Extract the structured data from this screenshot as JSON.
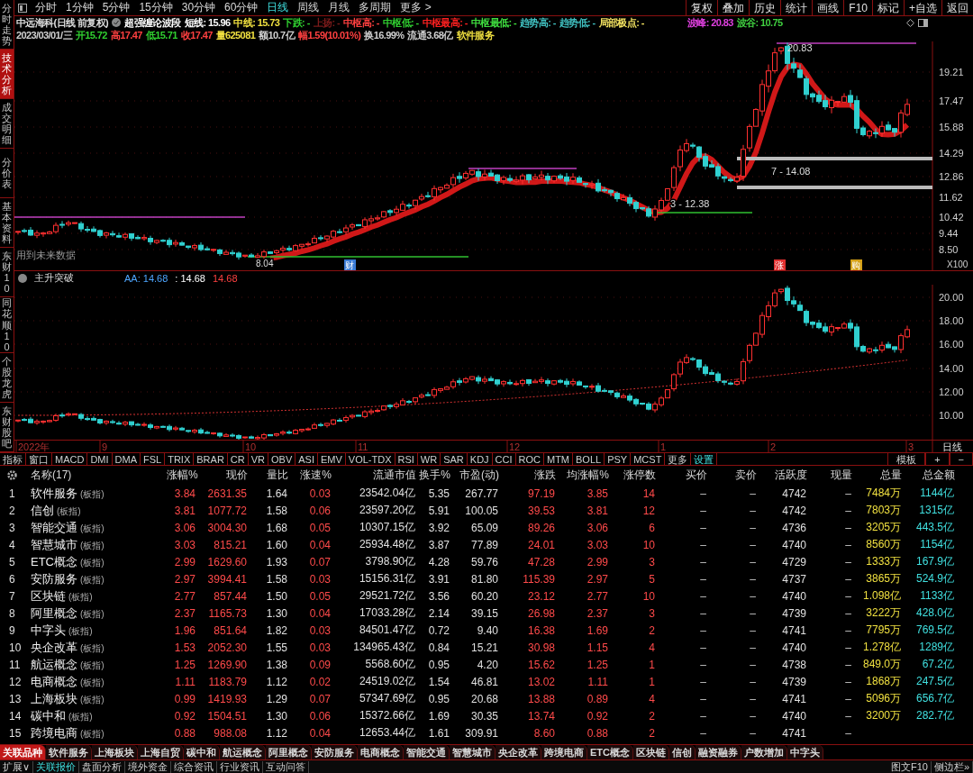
{
  "sidebar": {
    "tabs": [
      {
        "label": "分时走势",
        "selected": false
      },
      {
        "label": "技术分析",
        "selected": true
      },
      {
        "label": "成交明细",
        "selected": false
      },
      {
        "label": "分价表",
        "selected": false
      },
      {
        "label": "基本资料",
        "selected": false
      },
      {
        "label": "东财10",
        "selected": false
      },
      {
        "label": "同花顺10",
        "selected": false
      },
      {
        "label": "个股龙虎",
        "selected": false
      },
      {
        "label": "东财股吧",
        "selected": false
      }
    ]
  },
  "toolbar": {
    "periods": [
      {
        "label": "分时",
        "selected": false
      },
      {
        "label": "1分钟",
        "selected": false
      },
      {
        "label": "5分钟",
        "selected": false
      },
      {
        "label": "15分钟",
        "selected": false
      },
      {
        "label": "30分钟",
        "selected": false
      },
      {
        "label": "60分钟",
        "selected": false
      },
      {
        "label": "日线",
        "selected": true
      },
      {
        "label": "周线",
        "selected": false
      },
      {
        "label": "月线",
        "selected": false
      },
      {
        "label": "多周期",
        "selected": false
      },
      {
        "label": "更多 >",
        "selected": false
      }
    ],
    "buttons": [
      "复权",
      "叠加",
      "历史",
      "统计",
      "画线",
      "F10",
      "标记",
      "+自选",
      "返回"
    ]
  },
  "quote_header": {
    "title": "中远海科(日线 前复权)",
    "indicator": "超强缠论波段",
    "items": [
      {
        "text": "短线: 15.96",
        "color": "#ffffff"
      },
      {
        "text": "中线: 15.73",
        "color": "#f0e040"
      },
      {
        "text": "下跌: -",
        "color": "#30d030"
      },
      {
        "text": "上扬: -",
        "color": "#7a1a1a"
      },
      {
        "text": "中枢高: -",
        "color": "#ff4040"
      },
      {
        "text": "中枢低: -",
        "color": "#30d030"
      },
      {
        "text": "中枢最高: -",
        "color": "#ff2020"
      },
      {
        "text": "中枢最低: -",
        "color": "#40e040"
      },
      {
        "text": "趋势高: -",
        "color": "#40c0c0"
      },
      {
        "text": "趋势低: -",
        "color": "#40c0c0"
      },
      {
        "text": "局部极点: -",
        "color": "#f0e060"
      }
    ],
    "extremes": [
      {
        "text": "波峰: 20.83",
        "color": "#e040e0"
      },
      {
        "text": "波谷: 10.75",
        "color": "#40d040"
      }
    ]
  },
  "ohlc_line": [
    {
      "text": "2023/03/01/三",
      "color": "#d0d0d0"
    },
    {
      "text": "开15.72",
      "color": "#30d030"
    },
    {
      "text": "高17.47",
      "color": "#ff4040"
    },
    {
      "text": "低15.71",
      "color": "#30d030"
    },
    {
      "text": "收17.47",
      "color": "#ff4040"
    },
    {
      "text": "量625081",
      "color": "#f0e040"
    },
    {
      "text": "额10.7亿",
      "color": "#d0d0d0"
    },
    {
      "text": "幅1.59(10.01%)",
      "color": "#ff4040"
    },
    {
      "text": "换16.99%",
      "color": "#d0d0d0"
    },
    {
      "text": "流通3.68亿",
      "color": "#d0d0d0"
    },
    {
      "text": "软件服务",
      "color": "#f0e040"
    }
  ],
  "main_chart": {
    "y_labels": [
      "19.21",
      "17.47",
      "15.88",
      "14.29",
      "12.86",
      "11.62",
      "10.42",
      "9.44",
      "8.50"
    ],
    "scale": "X100",
    "peak_label": "20.83",
    "low_label": "8.04",
    "level_labels": [
      "7 - 14.08",
      "3 - 12.38"
    ],
    "note": "用到未来数据",
    "markers": [
      {
        "text": "财",
        "color": "#3a7bd5"
      },
      {
        "text": "涨",
        "color": "#e03030"
      },
      {
        "text": "购",
        "color": "#d4a017"
      }
    ]
  },
  "sub_chart": {
    "name": "主升突破",
    "values": [
      {
        "text": "AA: 14.68",
        "color": "#4da6ff"
      },
      {
        "text": ": 14.68",
        "color": "#ffffff"
      },
      {
        "text": "14.68",
        "color": "#ff4040"
      }
    ],
    "y_labels": [
      "20.00",
      "18.00",
      "16.00",
      "14.00",
      "12.00",
      "10.00"
    ]
  },
  "date_axis": {
    "labels": [
      "2022年",
      "9",
      "10",
      "11",
      "12",
      "1",
      "2",
      "3"
    ],
    "period": "日线"
  },
  "indicator_tabs": {
    "tabs": [
      "指标",
      "窗口",
      "MACD",
      "DMI",
      "DMA",
      "FSL",
      "TRIX",
      "BRAR",
      "CR",
      "VR",
      "OBV",
      "ASI",
      "EMV",
      "VOL-TDX",
      "RSI",
      "WR",
      "SAR",
      "KDJ",
      "CCI",
      "ROC",
      "MTM",
      "BOLL",
      "PSY",
      "MCST",
      "更多",
      "设置"
    ],
    "right": [
      "模板",
      "+",
      "−"
    ]
  },
  "table": {
    "name_header": "名称(17)",
    "columns": [
      {
        "label": "涨幅%",
        "color": "#ff4a4a"
      },
      {
        "label": "现价",
        "color": "#ff4a4a"
      },
      {
        "label": "量比",
        "color": "#e0e0e0"
      },
      {
        "label": "涨速%",
        "color": "#ff4a4a"
      },
      {
        "label": "流通市值",
        "color": "#e0e0e0"
      },
      {
        "label": "换手%",
        "color": "#e0e0e0"
      },
      {
        "label": "市盈(动)",
        "color": "#e0e0e0"
      },
      {
        "label": "涨跌",
        "color": "#ff4a4a"
      },
      {
        "label": "均涨幅%",
        "color": "#ff4a4a"
      },
      {
        "label": "涨停数",
        "color": "#ff4a4a"
      },
      {
        "label": "买价"
      },
      {
        "label": "卖价"
      },
      {
        "label": "活跃度",
        "color": "#e0e0e0"
      },
      {
        "label": "现量"
      },
      {
        "label": "总量",
        "color": "#f0e040"
      },
      {
        "label": "总金额",
        "color": "#40e0e0"
      }
    ],
    "rows": [
      {
        "index": "1",
        "name": "软件服务",
        "tag": "(板指)",
        "cells": [
          "3.84",
          "2631.35",
          "1.64",
          "0.03",
          "23542.04亿",
          "5.35",
          "267.77",
          "97.19",
          "3.85",
          "14",
          "–",
          "–",
          "4742",
          "–",
          "7484万",
          "1144亿"
        ]
      },
      {
        "index": "2",
        "name": "信创",
        "tag": "(板指)",
        "cells": [
          "3.81",
          "1077.72",
          "1.58",
          "0.06",
          "23597.20亿",
          "5.91",
          "100.05",
          "39.53",
          "3.81",
          "12",
          "–",
          "–",
          "4742",
          "–",
          "7803万",
          "1315亿"
        ]
      },
      {
        "index": "3",
        "name": "智能交通",
        "tag": "(板指)",
        "cells": [
          "3.06",
          "3004.30",
          "1.68",
          "0.05",
          "10307.15亿",
          "3.92",
          "65.09",
          "89.26",
          "3.06",
          "6",
          "–",
          "–",
          "4736",
          "–",
          "3205万",
          "443.5亿"
        ]
      },
      {
        "index": "4",
        "name": "智慧城市",
        "tag": "(板指)",
        "cells": [
          "3.03",
          "815.21",
          "1.60",
          "0.04",
          "25934.48亿",
          "3.87",
          "77.89",
          "24.01",
          "3.03",
          "10",
          "–",
          "–",
          "4740",
          "–",
          "8560万",
          "1154亿"
        ]
      },
      {
        "index": "5",
        "name": "ETC概念",
        "tag": "(板指)",
        "cells": [
          "2.99",
          "1629.60",
          "1.93",
          "0.07",
          "3798.90亿",
          "4.28",
          "59.76",
          "47.28",
          "2.99",
          "3",
          "–",
          "–",
          "4729",
          "–",
          "1333万",
          "167.9亿"
        ]
      },
      {
        "index": "6",
        "name": "安防服务",
        "tag": "(板指)",
        "cells": [
          "2.97",
          "3994.41",
          "1.58",
          "0.03",
          "15156.31亿",
          "3.91",
          "81.80",
          "115.39",
          "2.97",
          "5",
          "–",
          "–",
          "4737",
          "–",
          "3865万",
          "524.9亿"
        ]
      },
      {
        "index": "7",
        "name": "区块链",
        "tag": "(板指)",
        "cells": [
          "2.77",
          "857.44",
          "1.50",
          "0.05",
          "29521.72亿",
          "3.56",
          "60.20",
          "23.12",
          "2.77",
          "10",
          "–",
          "–",
          "4740",
          "–",
          "1.098亿",
          "1133亿"
        ]
      },
      {
        "index": "8",
        "name": "阿里概念",
        "tag": "(板指)",
        "cells": [
          "2.37",
          "1165.73",
          "1.30",
          "0.04",
          "17033.28亿",
          "2.14",
          "39.15",
          "26.98",
          "2.37",
          "3",
          "–",
          "–",
          "4739",
          "–",
          "3222万",
          "428.0亿"
        ]
      },
      {
        "index": "9",
        "name": "中字头",
        "tag": "(板指)",
        "cells": [
          "1.96",
          "851.64",
          "1.82",
          "0.03",
          "84501.47亿",
          "0.72",
          "9.40",
          "16.38",
          "1.69",
          "2",
          "–",
          "–",
          "4741",
          "–",
          "7795万",
          "769.5亿"
        ]
      },
      {
        "index": "10",
        "name": "央企改革",
        "tag": "(板指)",
        "cells": [
          "1.53",
          "2052.30",
          "1.55",
          "0.03",
          "134965.43亿",
          "0.84",
          "15.21",
          "30.98",
          "1.15",
          "4",
          "–",
          "–",
          "4740",
          "–",
          "1.278亿",
          "1289亿"
        ]
      },
      {
        "index": "11",
        "name": "航运概念",
        "tag": "(板指)",
        "cells": [
          "1.25",
          "1269.90",
          "1.38",
          "0.09",
          "5568.60亿",
          "0.95",
          "4.20",
          "15.62",
          "1.25",
          "1",
          "–",
          "–",
          "4738",
          "–",
          "849.0万",
          "67.2亿"
        ]
      },
      {
        "index": "12",
        "name": "电商概念",
        "tag": "(板指)",
        "cells": [
          "1.11",
          "1183.79",
          "1.12",
          "0.02",
          "24519.02亿",
          "1.54",
          "46.81",
          "13.02",
          "1.11",
          "1",
          "–",
          "–",
          "4739",
          "–",
          "1868万",
          "247.5亿"
        ]
      },
      {
        "index": "13",
        "name": "上海板块",
        "tag": "(板指)",
        "cells": [
          "0.99",
          "1419.93",
          "1.29",
          "0.07",
          "57347.69亿",
          "0.95",
          "20.68",
          "13.88",
          "0.89",
          "4",
          "–",
          "–",
          "4741",
          "–",
          "5096万",
          "656.7亿"
        ]
      },
      {
        "index": "14",
        "name": "碳中和",
        "tag": "(板指)",
        "cells": [
          "0.92",
          "1504.51",
          "1.30",
          "0.06",
          "15372.66亿",
          "1.69",
          "30.35",
          "13.74",
          "0.92",
          "2",
          "–",
          "–",
          "4740",
          "–",
          "3200万",
          "282.7亿"
        ]
      },
      {
        "index": "15",
        "name": "跨境电商",
        "tag": "(板指)",
        "cells": [
          "0.88",
          "988.08",
          "1.12",
          "0.04",
          "12653.44亿",
          "1.61",
          "309.91",
          "8.60",
          "0.88",
          "2",
          "–",
          "–",
          "4741",
          "–"
        ]
      }
    ]
  },
  "related_tabs": [
    {
      "label": "关联品种",
      "selected": true
    },
    {
      "label": "软件服务",
      "selected": false
    },
    {
      "label": "上海板块",
      "selected": false
    },
    {
      "label": "上海自贸",
      "selected": false
    },
    {
      "label": "碳中和",
      "selected": false
    },
    {
      "label": "航运概念",
      "selected": false
    },
    {
      "label": "阿里概念",
      "selected": false
    },
    {
      "label": "安防服务",
      "selected": false
    },
    {
      "label": "电商概念",
      "selected": false
    },
    {
      "label": "智能交通",
      "selected": false
    },
    {
      "label": "智慧城市",
      "selected": false
    },
    {
      "label": "央企改革",
      "selected": false
    },
    {
      "label": "跨境电商",
      "selected": false
    },
    {
      "label": "ETC概念",
      "selected": false
    },
    {
      "label": "区块链",
      "selected": false
    },
    {
      "label": "信创",
      "selected": false
    },
    {
      "label": "融资融券",
      "selected": false
    },
    {
      "label": "户数增加",
      "selected": false
    },
    {
      "label": "中字头",
      "selected": false
    }
  ],
  "bottom_bar": {
    "items": [
      "扩展∨",
      "关联报价",
      "盘面分析",
      "境外资金",
      "综合资讯",
      "行业资讯",
      "互动问答"
    ],
    "right": [
      "图文F10",
      "侧边栏»"
    ]
  }
}
